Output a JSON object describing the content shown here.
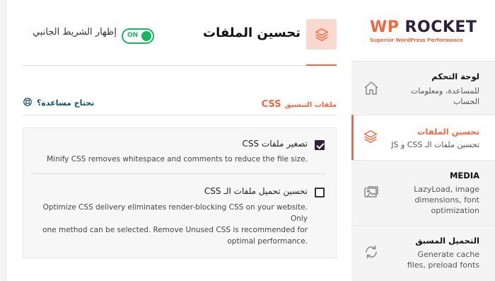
{
  "header": {
    "title": "تحسين الملفات",
    "toggle_label": "إظهار الشريط الجانبي",
    "toggle_state": "ON"
  },
  "section": {
    "prefix": "ملفات التنسيق",
    "title": "CSS",
    "help_link": "تحتاج مساعدة؟"
  },
  "options": [
    {
      "label": "تصغير ملفات CSS",
      "checked": true,
      "description": "Minify CSS removes whitespace and comments to reduce the file size."
    },
    {
      "label": "تحسين تحميل ملفات الـ CSS",
      "checked": false,
      "description_lines": [
        "Optimize CSS delivery eliminates render-blocking CSS on your website. Only",
        "one method can be selected. Remove Unused CSS is recommended for",
        "optimal performance."
      ]
    }
  ],
  "sidebar": {
    "logo": {
      "wp": "WP",
      "rocket": " ROCKET",
      "tagline": "Superior WordPress Performance"
    },
    "items": [
      {
        "title": "لوحة التحكم",
        "subtitle": "للمساعدة، ومعلومات الحساب",
        "icon": "home-icon",
        "active": false
      },
      {
        "title": "تحسين الملفات",
        "subtitle": "تحسين ملفات الـ CSS و JS",
        "icon": "layers-icon",
        "active": true
      },
      {
        "title": "MEDIA",
        "subtitle": "LazyLoad, image dimensions, font optimization",
        "icon": "image-icon",
        "active": false
      },
      {
        "title": "التحميل المسبق",
        "subtitle": "Generate cache files, preload fonts",
        "icon": "refresh-icon",
        "active": false
      }
    ]
  },
  "colors": {
    "accent": "#f56640",
    "toggle_on": "#19b55e",
    "checkbox_checked": "#2d1f3d",
    "help_link": "#0d4d6b"
  }
}
